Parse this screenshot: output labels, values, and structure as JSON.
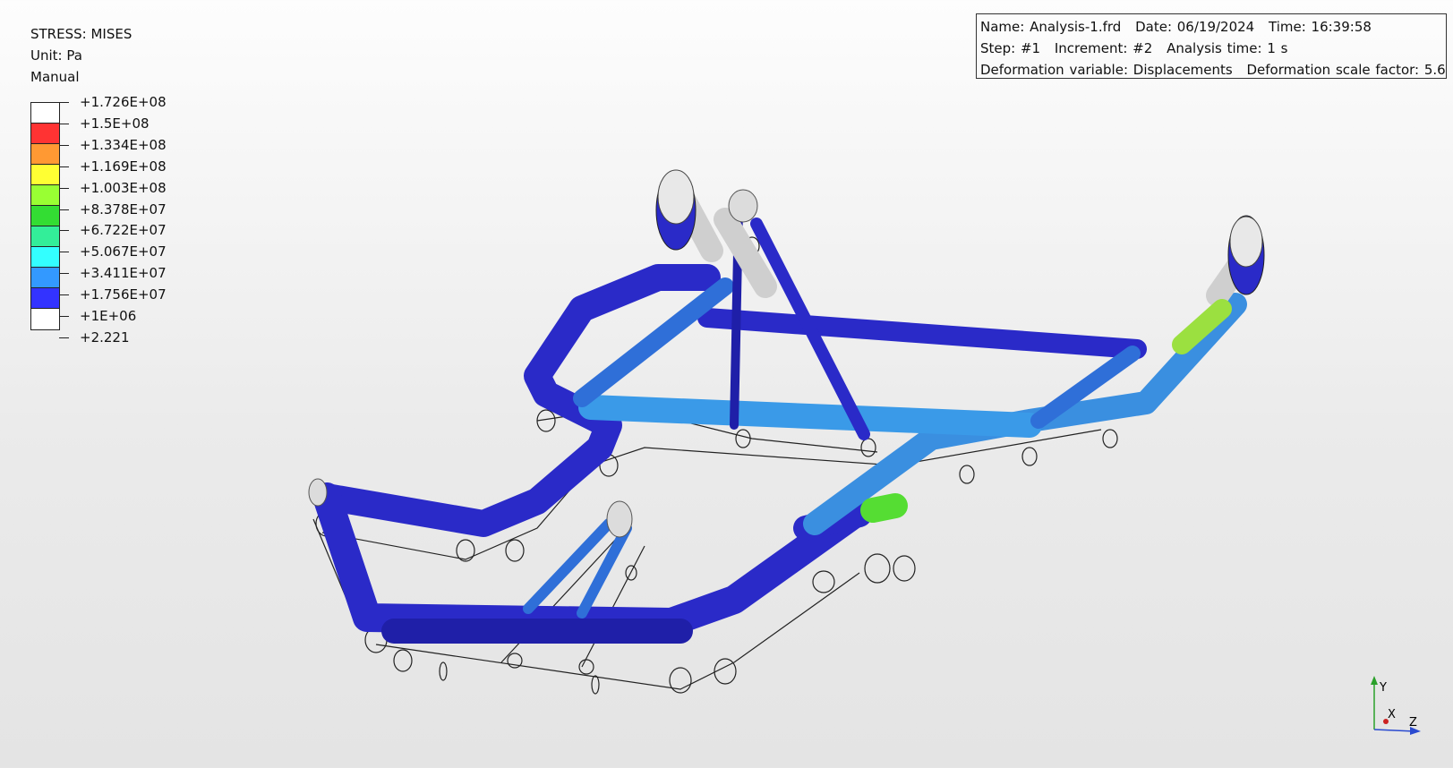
{
  "legend": {
    "title": "STRESS: MISES",
    "unit": "Unit: Pa",
    "mode": "Manual",
    "colors": [
      "#ffffff",
      "#ff3333",
      "#ff9933",
      "#ffff33",
      "#99ff33",
      "#33dd33",
      "#33ee99",
      "#33ffff",
      "#3399ff",
      "#3333ff",
      "#ffffff"
    ],
    "ticks": [
      "+1.726E+08",
      "+1.5E+08",
      "+1.334E+08",
      "+1.169E+08",
      "+1.003E+08",
      "+8.378E+07",
      "+6.722E+07",
      "+5.067E+07",
      "+3.411E+07",
      "+1.756E+07",
      "+1E+06",
      "+2.221"
    ]
  },
  "info": {
    "name": "Name: Analysis-1.frd",
    "date": "Date: 06/19/2024",
    "time": "Time: 16:39:58",
    "step": "Step: #1",
    "increment": "Increment: #2",
    "analysis_time": "Analysis time: 1 s",
    "deformation_variable": "Deformation variable: Displacements",
    "deformation_scale": "Deformation scale factor: 5.6"
  },
  "axes": {
    "y": "Y",
    "x": "X",
    "z": "Z"
  }
}
